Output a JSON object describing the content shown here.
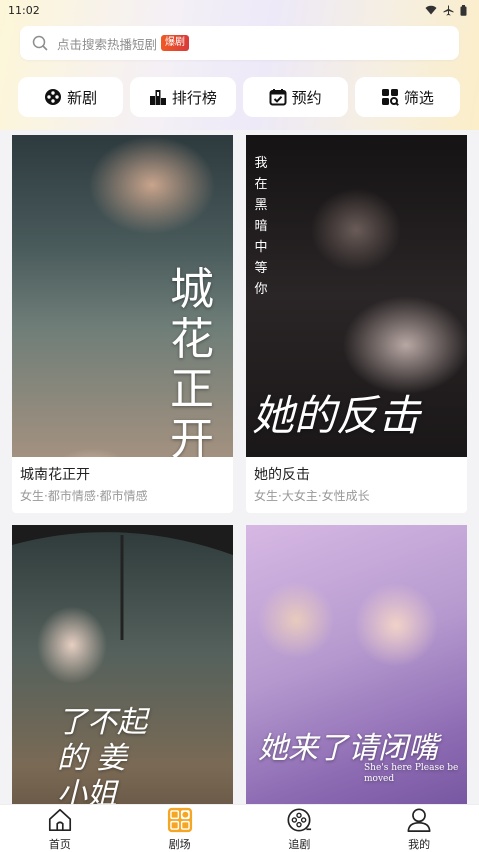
{
  "status_bar": {
    "time": "11:02"
  },
  "search": {
    "placeholder": "点击搜索热播短剧",
    "badge": "爆剧"
  },
  "quick_nav": [
    {
      "label": "新剧",
      "icon": "film-reel-icon"
    },
    {
      "label": "排行榜",
      "icon": "ranking-icon"
    },
    {
      "label": "预约",
      "icon": "calendar-check-icon"
    },
    {
      "label": "筛选",
      "icon": "filter-grid-icon"
    }
  ],
  "dramas": [
    {
      "title": "城南花正开",
      "tags": "女生·都市情感·都市情感",
      "poster_text": "城 花 正开"
    },
    {
      "title": "她的反击",
      "tags": "女生·大女主·女性成长",
      "poster_text": "她的反击",
      "poster_vertical": "我在黑暗中等你"
    },
    {
      "title": "",
      "tags": "",
      "poster_text": "了不起的 姜小姐"
    },
    {
      "title": "",
      "tags": "",
      "poster_text": "她来了请闭嘴",
      "poster_sub": "She's here Please be moved"
    }
  ],
  "tab_bar": [
    {
      "label": "首页",
      "icon": "home-icon"
    },
    {
      "label": "剧场",
      "icon": "theater-grid-icon",
      "active": true
    },
    {
      "label": "追剧",
      "icon": "follow-film-icon"
    },
    {
      "label": "我的",
      "icon": "profile-icon"
    }
  ],
  "colors": {
    "accent": "#f5a623",
    "badge": "#e8452e",
    "background": "#f3f3f5"
  }
}
